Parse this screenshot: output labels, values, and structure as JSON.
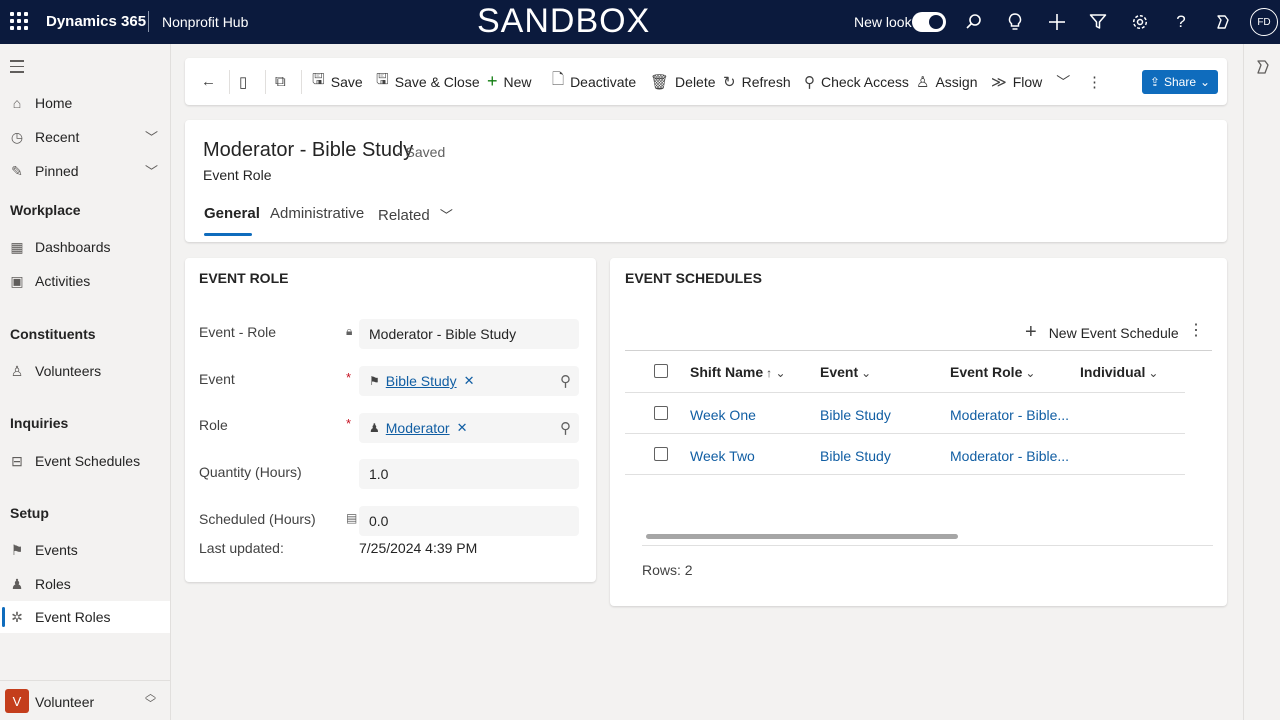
{
  "topbar": {
    "brand": "Dynamics 365",
    "app_name": "Nonprofit Hub",
    "environment_banner": "SANDBOX",
    "new_look_label": "New look",
    "new_look_enabled": true,
    "user_initials": "FD",
    "icons": [
      "waffle-icon",
      "search-icon",
      "lightbulb-icon",
      "plus-icon",
      "filter-icon",
      "gear-icon",
      "help-icon",
      "copilot-icon"
    ]
  },
  "sidebar": {
    "items": [
      {
        "label": "Home",
        "icon": "home-icon"
      },
      {
        "label": "Recent",
        "icon": "clock-icon",
        "expandable": true
      },
      {
        "label": "Pinned",
        "icon": "pin-icon",
        "expandable": true
      }
    ],
    "groups": [
      {
        "title": "Workplace",
        "items": [
          {
            "label": "Dashboards",
            "icon": "dashboard-icon"
          },
          {
            "label": "Activities",
            "icon": "activities-icon"
          }
        ]
      },
      {
        "title": "Constituents",
        "items": [
          {
            "label": "Volunteers",
            "icon": "person-icon"
          }
        ]
      },
      {
        "title": "Inquiries",
        "items": [
          {
            "label": "Event Schedules",
            "icon": "schedule-icon"
          }
        ]
      },
      {
        "title": "Setup",
        "items": [
          {
            "label": "Events",
            "icon": "flag-icon"
          },
          {
            "label": "Roles",
            "icon": "role-icon"
          },
          {
            "label": "Event Roles",
            "icon": "event-roles-icon",
            "active": true
          }
        ]
      }
    ],
    "area": {
      "badge": "V",
      "label": "Volunteer"
    }
  },
  "commands": {
    "save": "Save",
    "save_close": "Save & Close",
    "new": "New",
    "deactivate": "Deactivate",
    "delete": "Delete",
    "refresh": "Refresh",
    "check_access": "Check Access",
    "assign": "Assign",
    "flow": "Flow",
    "share": "Share"
  },
  "record": {
    "title": "Moderator - Bible Study",
    "status": "- Saved",
    "entity": "Event Role",
    "tabs": [
      "General",
      "Administrative",
      "Related"
    ],
    "active_tab": "General"
  },
  "form": {
    "section_title": "EVENT ROLE",
    "fields": {
      "event_role": {
        "label": "Event - Role",
        "value": "Moderator - Bible Study",
        "locked": true
      },
      "event": {
        "label": "Event",
        "value": "Bible Study",
        "required": true
      },
      "role": {
        "label": "Role",
        "value": "Moderator",
        "required": true
      },
      "quantity": {
        "label": "Quantity (Hours)",
        "value": "1.0"
      },
      "scheduled": {
        "label": "Scheduled (Hours)",
        "value": "0.0"
      }
    },
    "last_updated_label": "Last updated:",
    "last_updated_value": "7/25/2024 4:39 PM"
  },
  "schedules": {
    "section_title": "EVENT SCHEDULES",
    "new_button": "New Event Schedule",
    "columns": [
      "Shift Name",
      "Event",
      "Event Role",
      "Individual"
    ],
    "rows": [
      {
        "shift_name": "Week One",
        "event": "Bible Study",
        "event_role": "Moderator - Bible..."
      },
      {
        "shift_name": "Week Two",
        "event": "Bible Study",
        "event_role": "Moderator - Bible..."
      }
    ],
    "rows_label": "Rows: 2"
  }
}
